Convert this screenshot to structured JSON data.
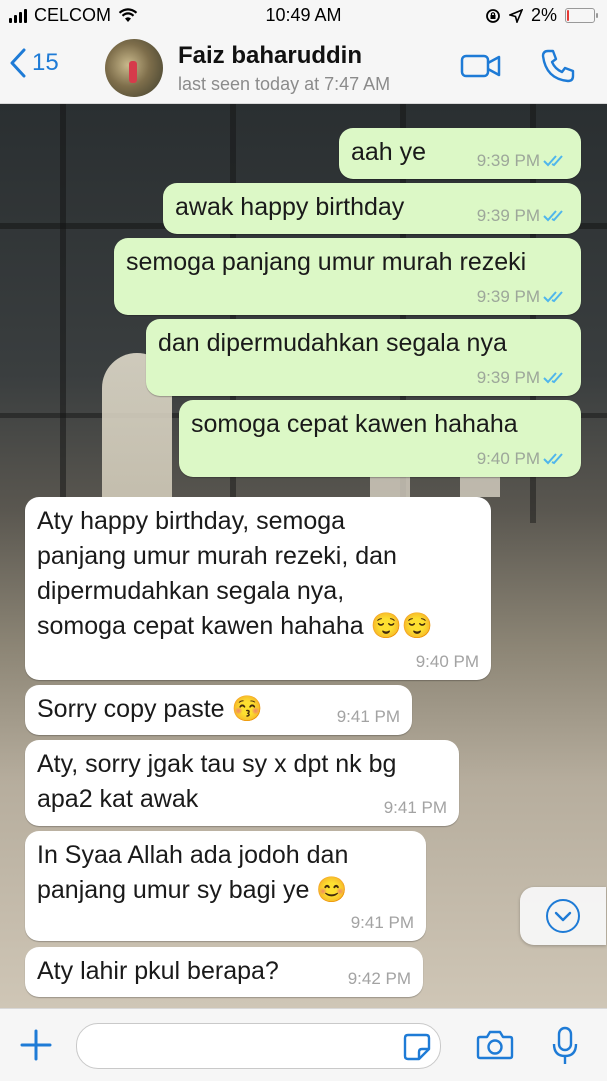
{
  "status_bar": {
    "carrier": "CELCOM",
    "time": "10:49 AM",
    "battery": "2%",
    "battery_level": 0.02
  },
  "header": {
    "back_count": "15",
    "contact_name": "Faiz baharuddin",
    "last_seen": "last seen today at 7:47 AM"
  },
  "messages": [
    {
      "dir": "out",
      "text": "aah ye",
      "time": "9:39 PM"
    },
    {
      "dir": "out",
      "text": "awak happy birthday",
      "time": "9:39 PM"
    },
    {
      "dir": "out",
      "text": "semoga panjang umur murah rezeki",
      "time": "9:39 PM"
    },
    {
      "dir": "out",
      "text": "dan dipermudahkan segala nya",
      "time": "9:39 PM"
    },
    {
      "dir": "out",
      "text": "somoga cepat kawen hahaha",
      "time": "9:40 PM"
    },
    {
      "dir": "in",
      "text": "Aty happy birthday, semoga\npanjang umur murah rezeki, dan\ndipermudahkan segala nya,\nsomoga cepat kawen hahaha 😌😌",
      "time": "9:40 PM"
    },
    {
      "dir": "in",
      "text": "Sorry copy paste 😚",
      "time": "9:41 PM"
    },
    {
      "dir": "in",
      "text": "Aty, sorry jgak tau sy x dpt nk bg\napa2 kat awak",
      "time": "9:41 PM"
    },
    {
      "dir": "in",
      "text": "In Syaa Allah ada jodoh dan\npanjang umur sy bagi ye 😊",
      "time": "9:41 PM"
    },
    {
      "dir": "in",
      "text": "Aty lahir pkul berapa?",
      "time": "9:42 PM"
    }
  ],
  "colors": {
    "outgoing": "#dcf8c6",
    "incoming": "#ffffff",
    "accent": "#1e7bd6",
    "read_ticks": "#4fb6ec"
  },
  "icons": [
    "back-chevron-icon",
    "video-call-icon",
    "phone-icon",
    "chevron-down-icon",
    "plus-icon",
    "sticker-icon",
    "camera-icon",
    "microphone-icon"
  ]
}
